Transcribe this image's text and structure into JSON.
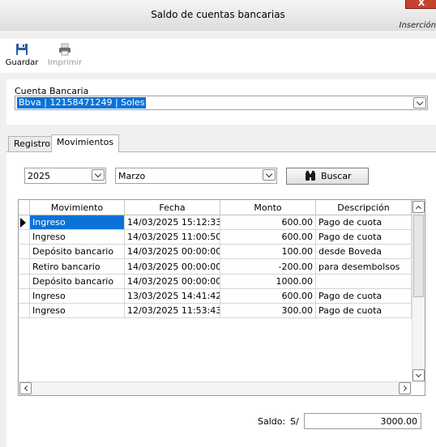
{
  "window": {
    "title": "Saldo de cuentas bancarias",
    "close_label": "X",
    "mode": "Inserción"
  },
  "toolbar": {
    "save_label": "Guardar",
    "save_icon": "floppy-disk-icon",
    "print_label": "Imprimir",
    "print_icon": "printer-icon"
  },
  "account": {
    "label": "Cuenta Bancaria",
    "value": "Bbva | 12158471249 | Soles"
  },
  "tabs": [
    {
      "label": "Registro",
      "active": false
    },
    {
      "label": "Movimientos",
      "active": true
    }
  ],
  "filters": {
    "year": "2025",
    "month": "Marzo",
    "search_label": "Buscar",
    "search_icon": "binoculars-icon"
  },
  "grid": {
    "columns": [
      "Movimiento",
      "Fecha",
      "Monto",
      "Descripción"
    ],
    "rows": [
      {
        "movimiento": "Ingreso",
        "fecha": "14/03/2025 15:12:33",
        "monto": "600.00",
        "descripcion": "Pago de cuota",
        "selected": true
      },
      {
        "movimiento": "Ingreso",
        "fecha": "14/03/2025 11:00:50",
        "monto": "600.00",
        "descripcion": "Pago de cuota",
        "selected": false
      },
      {
        "movimiento": "Depósito bancario",
        "fecha": "14/03/2025 00:00:00",
        "monto": "100.00",
        "descripcion": "desde Boveda",
        "selected": false
      },
      {
        "movimiento": "Retiro bancario",
        "fecha": "14/03/2025 00:00:00",
        "monto": "-200.00",
        "descripcion": "para desembolsos",
        "selected": false
      },
      {
        "movimiento": "Depósito bancario",
        "fecha": "14/03/2025 00:00:00",
        "monto": "1000.00",
        "descripcion": "",
        "selected": false
      },
      {
        "movimiento": "Ingreso",
        "fecha": "13/03/2025 14:41:42",
        "monto": "600.00",
        "descripcion": "Pago de cuota",
        "selected": false
      },
      {
        "movimiento": "Ingreso",
        "fecha": "12/03/2025 11:53:43",
        "monto": "300.00",
        "descripcion": "Pago de cuota",
        "selected": false
      }
    ]
  },
  "footer": {
    "saldo_label": "Saldo:",
    "currency": "S/",
    "saldo_value": "3000.00"
  },
  "colors": {
    "selection": "#0a73d8",
    "window_bg": "#f0f0f0"
  }
}
